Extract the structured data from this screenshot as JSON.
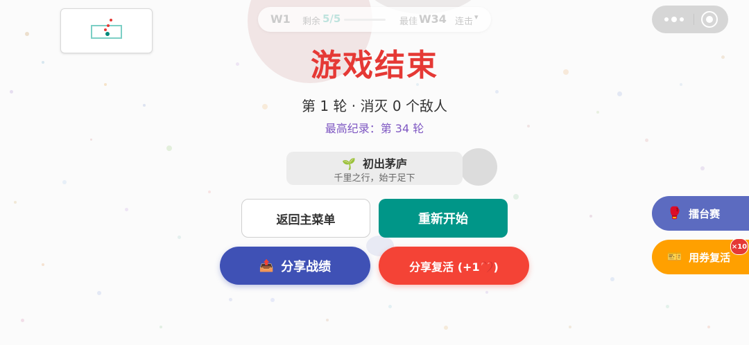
{
  "hud": {
    "wave": "W1",
    "remaining_label": "剩余",
    "remaining_value": "5/5",
    "best_label": "最佳",
    "best_value": "W34",
    "streak_label": "连击"
  },
  "gameover": {
    "title": "游戏结束",
    "stats": "第 1 轮 · 消灭 0 个敌人",
    "record": "最高纪录：第 34 轮"
  },
  "achievement": {
    "icon": "🌱",
    "title": "初出茅庐",
    "description": "千里之行，始于足下"
  },
  "buttons": {
    "menu": "返回主菜单",
    "restart": "重新开始",
    "share_icon": "📤",
    "share": "分享战绩",
    "revive": "分享复活 (+1❤️)"
  },
  "side": {
    "arena_icon": "🥊",
    "arena": "擂台赛",
    "ticket_icon": "🎫",
    "ticket": "用券复活",
    "ticket_badge": "×10"
  },
  "colors": {
    "title": "#e53935",
    "record": "#7e57c2",
    "restart": "#009688",
    "share": "#3f51b5",
    "revive": "#f44336",
    "arena": "#5c6bc0",
    "ticket": "#ffa000"
  }
}
